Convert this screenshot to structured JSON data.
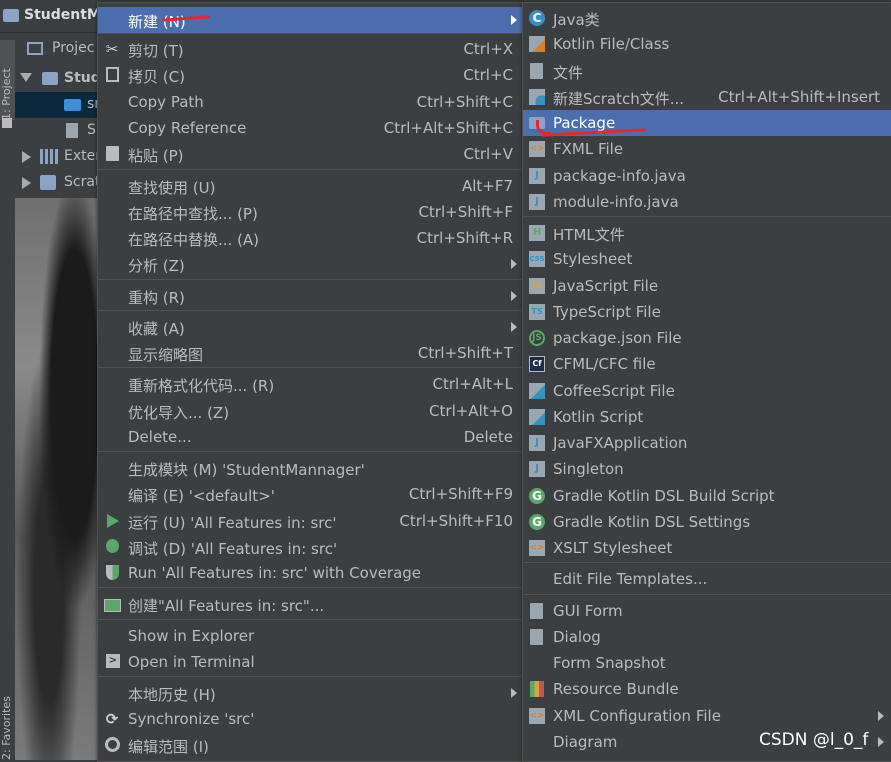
{
  "project": {
    "title": "StudentM",
    "sidebar_tab": "1: Project",
    "favorites_tab": "2: Favorites",
    "tree": [
      {
        "label": "Projec"
      },
      {
        "label": "Stud"
      },
      {
        "label": "sr"
      },
      {
        "label": "S"
      },
      {
        "label": "Exter"
      },
      {
        "label": "Scrat"
      }
    ]
  },
  "context_menu": [
    {
      "label": "新建 (N)",
      "shortcut": "",
      "submenu": true
    },
    {
      "label": "剪切 (T)",
      "shortcut": "Ctrl+X",
      "icon": "scissors-icon"
    },
    {
      "label": "拷贝 (C)",
      "shortcut": "Ctrl+C",
      "icon": "copy-icon"
    },
    {
      "label": "Copy Path",
      "shortcut": "Ctrl+Shift+C"
    },
    {
      "label": "Copy Reference",
      "shortcut": "Ctrl+Alt+Shift+C"
    },
    {
      "label": "粘贴 (P)",
      "shortcut": "Ctrl+V",
      "icon": "paste-icon"
    },
    {
      "label": "查找使用 (U)",
      "shortcut": "Alt+F7"
    },
    {
      "label": "在路径中查找... (P)",
      "shortcut": "Ctrl+Shift+F"
    },
    {
      "label": "在路径中替换... (A)",
      "shortcut": "Ctrl+Shift+R"
    },
    {
      "label": "分析 (Z)",
      "shortcut": "",
      "submenu": true
    },
    {
      "label": "重构 (R)",
      "shortcut": "",
      "submenu": true
    },
    {
      "label": "收藏 (A)",
      "shortcut": "",
      "submenu": true
    },
    {
      "label": "显示缩略图",
      "shortcut": "Ctrl+Shift+T"
    },
    {
      "label": "重新格式化代码... (R)",
      "shortcut": "Ctrl+Alt+L"
    },
    {
      "label": "优化导入... (Z)",
      "shortcut": "Ctrl+Alt+O"
    },
    {
      "label": "Delete...",
      "shortcut": "Delete"
    },
    {
      "label": "生成模块 (M) 'StudentMannager'",
      "shortcut": ""
    },
    {
      "label": "编译 (E) '<default>'",
      "shortcut": "Ctrl+Shift+F9"
    },
    {
      "label": "运行 (U) 'All Features in: src'",
      "shortcut": "Ctrl+Shift+F10",
      "icon": "run-icon"
    },
    {
      "label": "调试 (D) 'All Features in: src'",
      "shortcut": "",
      "icon": "debug-icon"
    },
    {
      "label": "Run 'All Features in: src' with Coverage",
      "shortcut": "",
      "icon": "coverage-icon"
    },
    {
      "label": "创建\"All Features in: src\"...",
      "shortcut": "",
      "icon": "create-config-icon"
    },
    {
      "label": "Show in Explorer",
      "shortcut": ""
    },
    {
      "label": "Open in Terminal",
      "shortcut": "",
      "icon": "terminal-icon"
    },
    {
      "label": "本地历史 (H)",
      "shortcut": "",
      "submenu": true
    },
    {
      "label": "Synchronize 'src'",
      "shortcut": "",
      "icon": "sync-icon"
    },
    {
      "label": "编辑范围 (I)",
      "shortcut": "",
      "icon": "scope-icon"
    }
  ],
  "new_submenu": [
    {
      "label": "Java类",
      "shortcut": "",
      "icon": "java-class-icon"
    },
    {
      "label": "Kotlin File/Class",
      "shortcut": "",
      "icon": "kotlin-file-icon"
    },
    {
      "label": "文件",
      "shortcut": "",
      "icon": "file-icon"
    },
    {
      "label": "新建Scratch文件...",
      "shortcut": "Ctrl+Alt+Shift+Insert",
      "icon": "scratch-file-icon"
    },
    {
      "label": "Package",
      "shortcut": "",
      "icon": "package-icon"
    },
    {
      "label": "FXML File",
      "shortcut": "",
      "icon": "fxml-file-icon"
    },
    {
      "label": "package-info.java",
      "shortcut": "",
      "icon": "java-file-icon"
    },
    {
      "label": "module-info.java",
      "shortcut": "",
      "icon": "java-file-icon"
    },
    {
      "label": "HTML文件",
      "shortcut": "",
      "icon": "html-file-icon"
    },
    {
      "label": "Stylesheet",
      "shortcut": "",
      "icon": "css-file-icon"
    },
    {
      "label": "JavaScript File",
      "shortcut": "",
      "icon": "js-file-icon"
    },
    {
      "label": "TypeScript File",
      "shortcut": "",
      "icon": "ts-file-icon"
    },
    {
      "label": "package.json File",
      "shortcut": "",
      "icon": "nodejs-icon"
    },
    {
      "label": "CFML/CFC file",
      "shortcut": "",
      "icon": "cfml-icon"
    },
    {
      "label": "CoffeeScript File",
      "shortcut": "",
      "icon": "coffeescript-icon"
    },
    {
      "label": "Kotlin Script",
      "shortcut": "",
      "icon": "kotlin-script-icon"
    },
    {
      "label": "JavaFXApplication",
      "shortcut": "",
      "icon": "javafx-icon"
    },
    {
      "label": "Singleton",
      "shortcut": "",
      "icon": "singleton-icon"
    },
    {
      "label": "Gradle Kotlin DSL Build Script",
      "shortcut": "",
      "icon": "gradle-icon"
    },
    {
      "label": "Gradle Kotlin DSL Settings",
      "shortcut": "",
      "icon": "gradle-icon"
    },
    {
      "label": "XSLT Stylesheet",
      "shortcut": "",
      "icon": "xslt-icon"
    },
    {
      "label": "Edit File Templates...",
      "shortcut": ""
    },
    {
      "label": "GUI Form",
      "shortcut": "",
      "icon": "gui-form-icon"
    },
    {
      "label": "Dialog",
      "shortcut": "",
      "icon": "dialog-icon"
    },
    {
      "label": "Form Snapshot",
      "shortcut": ""
    },
    {
      "label": "Resource Bundle",
      "shortcut": "",
      "icon": "resource-bundle-icon"
    },
    {
      "label": "XML Configuration File",
      "shortcut": "",
      "icon": "xml-file-icon",
      "submenu": true
    },
    {
      "label": "Diagram",
      "shortcut": "",
      "submenu": true
    }
  ],
  "watermark": "CSDN @l_0_f",
  "colors": {
    "menu_bg": "#3c3f41",
    "highlight": "#4b6eaf",
    "annotation_red": "#e0282d"
  }
}
